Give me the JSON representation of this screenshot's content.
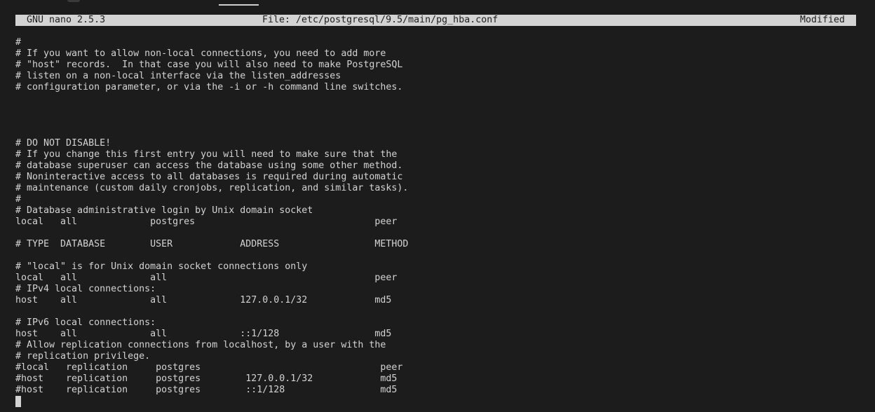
{
  "title_bar": {
    "app": "GNU nano 2.5.3",
    "file": "File: /etc/postgresql/9.5/main/pg_hba.conf",
    "status": "Modified"
  },
  "lines": [
    "#",
    "# If you want to allow non-local connections, you need to add more",
    "# \"host\" records.  In that case you will also need to make PostgreSQL",
    "# listen on a non-local interface via the listen_addresses",
    "# configuration parameter, or via the -i or -h command line switches.",
    "",
    "",
    "",
    "",
    "# DO NOT DISABLE!",
    "# If you change this first entry you will need to make sure that the",
    "# database superuser can access the database using some other method.",
    "# Noninteractive access to all databases is required during automatic",
    "# maintenance (custom daily cronjobs, replication, and similar tasks).",
    "#",
    "# Database administrative login by Unix domain socket",
    "local   all             postgres                                peer",
    "",
    "# TYPE  DATABASE        USER            ADDRESS                 METHOD",
    "",
    "# \"local\" is for Unix domain socket connections only",
    "local   all             all                                     peer",
    "# IPv4 local connections:",
    "host    all             all             127.0.0.1/32            md5",
    "",
    "# IPv6 local connections:",
    "host    all             all             ::1/128                 md5",
    "# Allow replication connections from localhost, by a user with the",
    "# replication privilege.",
    "#local   replication     postgres                                peer",
    "#host    replication     postgres        127.0.0.1/32            md5",
    "#host    replication     postgres        ::1/128                 md5"
  ]
}
